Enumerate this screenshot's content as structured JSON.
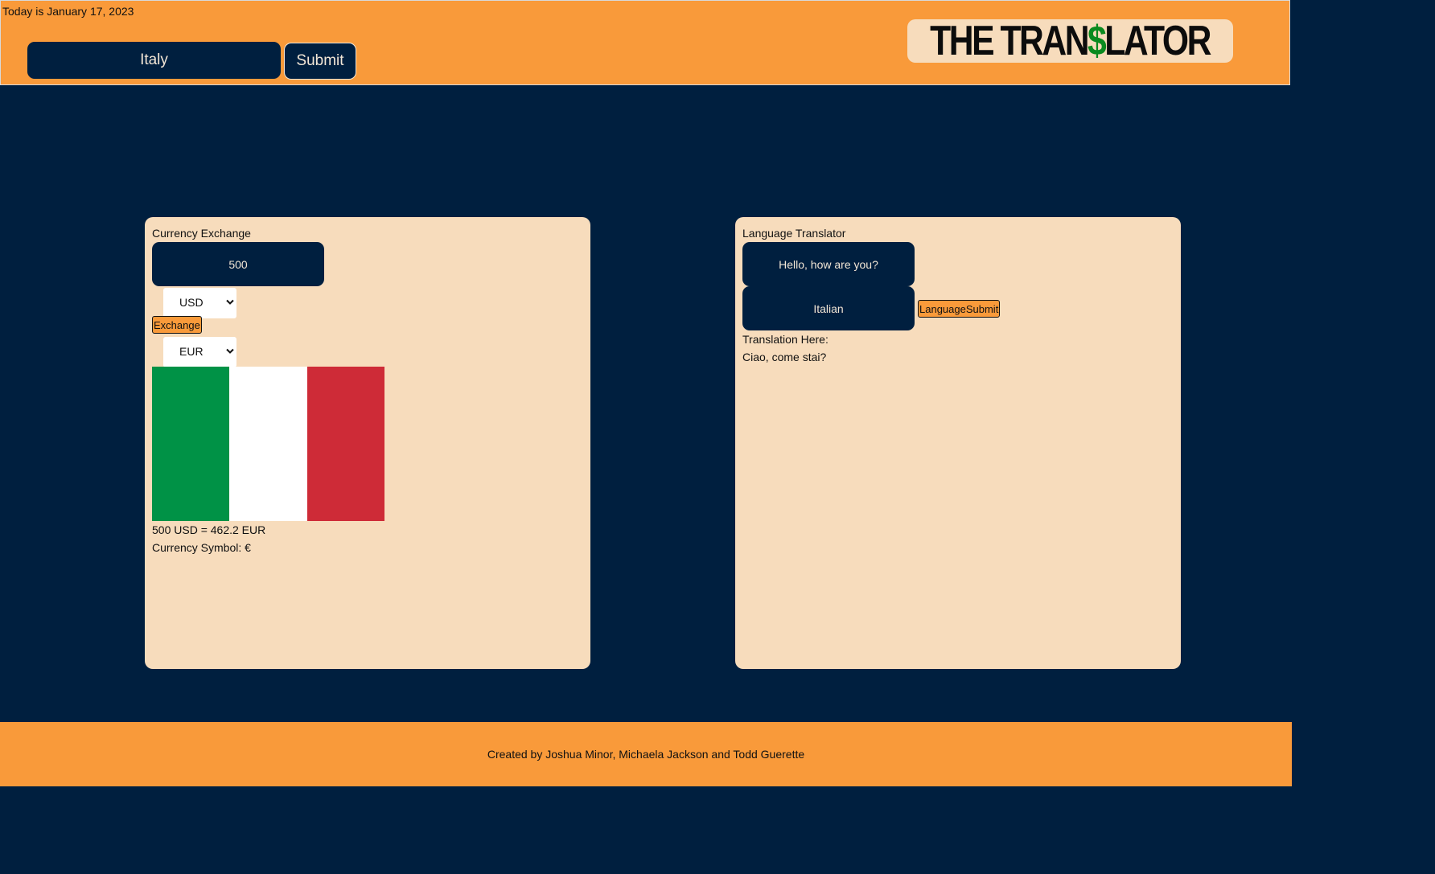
{
  "header": {
    "date_text": "Today is January 17, 2023",
    "country_input_value": "Italy",
    "submit_label": "Submit",
    "logo": {
      "part1": "THE TRAN",
      "dollar": "$",
      "part2": "LATOR"
    }
  },
  "currency": {
    "title": "Currency Exchange",
    "amount_value": "500",
    "from_currency": "USD",
    "exchange_label": "Exchange",
    "to_currency": "EUR",
    "flag_icon": "italy-flag",
    "result_text": "500 USD = 462.2 EUR",
    "symbol_text": "Currency Symbol: €"
  },
  "language": {
    "title": "Language Translator",
    "phrase_value": "Hello, how are you?",
    "language_value": "Italian",
    "submit_label": "LanguageSubmit",
    "translation_label": "Translation Here:",
    "translation_result": "Ciao, come stai?"
  },
  "footer": {
    "credits": "Created by Joshua Minor, Michaela Jackson and Todd Guerette"
  },
  "colors": {
    "background": "#001f3f",
    "header_footer": "#f99a3a",
    "panel": "#f7dcbc",
    "dark_input": "#001f3f",
    "flag_green": "#009246",
    "flag_white": "#ffffff",
    "flag_red": "#ce2b37",
    "logo_dollar": "#0a8a1f"
  }
}
